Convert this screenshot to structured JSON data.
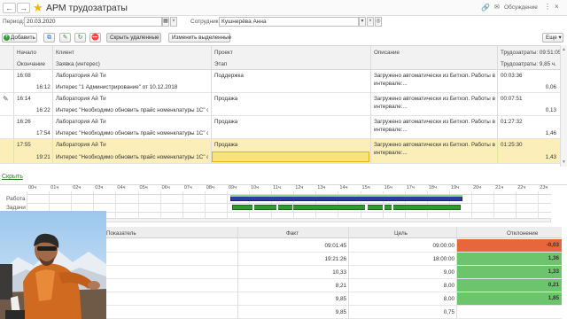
{
  "window": {
    "title": "АРМ трудозатраты",
    "discussion": "Обсуждение"
  },
  "filters": {
    "period_label": "Период:",
    "period_value": "20.03.2020",
    "employee_label": "Сотрудник:",
    "employee_value": "Кушнерёва Анна"
  },
  "toolbar": {
    "add": "Добавить",
    "show_deleted": "Скрыть удаленные",
    "change_selected": "Изменить выделенные",
    "more": "Еще"
  },
  "table": {
    "headers": {
      "start": "Начало",
      "end": "Окончание",
      "client": "Клиент",
      "request": "Заявка (интерес)",
      "project": "Проект",
      "stage": "Этап",
      "description": "Описание",
      "labor": "Трудозатраты: 09:51:05",
      "labor2": "Трудозатраты: 9,85 ч."
    },
    "rows": [
      {
        "start": "16:08",
        "end": "16:12",
        "client": "Лаборатория Ай Ти",
        "request": "Интерес \"1 Администрирование\" от 10.12.2018",
        "project": "Поддержка",
        "stage": "",
        "desc1": "Загружено автоматически из Битхоп. Работы в",
        "desc2": "интервале:...",
        "time": "00:03:36",
        "hours": "0,06"
      },
      {
        "start": "16:14",
        "end": "16:22",
        "client": "Лаборатория Ай Ти",
        "request": "Интерес \"Необходимо обновить прайс номенклатуры 1С\" от ...",
        "project": "Продажа",
        "stage": "",
        "desc1": "Загружено автоматически из Битхоп. Работы в",
        "desc2": "интервале:...",
        "time": "00:07:51",
        "hours": "0,13"
      },
      {
        "start": "16:26",
        "end": "17:54",
        "client": "Лаборатория Ай Ти",
        "request": "Интерес \"Необходимо обновить прайс номенклатуры 1С\" от ...",
        "project": "Продажа",
        "stage": "",
        "desc1": "Загружено автоматически из Битхоп. Работы в",
        "desc2": "интервале:...",
        "time": "01:27:32",
        "hours": "1,46"
      },
      {
        "start": "17:55",
        "end": "19:21",
        "client": "Лаборатория Ай Ти",
        "request": "Интерес \"Необходимо обновить прайс номенклатуры 1С\" от ...",
        "project": "Продажа",
        "stage": "",
        "desc1": "Загружено автоматически из Битхоп. Работы в",
        "desc2": "интервале:...",
        "time": "01:25:30",
        "hours": "1,43"
      }
    ]
  },
  "hide_link": "Скрыть",
  "timeline": {
    "hours": [
      "00ч",
      "01ч",
      "02ч",
      "03ч",
      "04ч",
      "05ч",
      "06ч",
      "07ч",
      "08ч",
      "09ч",
      "10ч",
      "11ч",
      "12ч",
      "13ч",
      "14ч",
      "15ч",
      "16ч",
      "17ч",
      "18ч",
      "19ч",
      "20ч",
      "21ч",
      "22ч",
      "23ч"
    ],
    "rows": [
      "Работа",
      "Задачи"
    ]
  },
  "indicators": {
    "headers": {
      "name": "Показатель",
      "fact": "Факт",
      "goal": "Цель",
      "dev": "Отклонение"
    },
    "rows": [
      {
        "fact": "09:01:45",
        "goal": "09:00:00",
        "dev": "-0,03",
        "color": "#e8663c"
      },
      {
        "fact": "19:21:26",
        "goal": "18:00:00",
        "dev": "1,36",
        "color": "#6cc56c"
      },
      {
        "fact": "10,33",
        "goal": "9,00",
        "dev": "1,33",
        "color": "#6cc56c"
      },
      {
        "fact": "8,21",
        "goal": "8,00",
        "dev": "0,21",
        "color": "#6cc56c"
      },
      {
        "fact": "9,85",
        "goal": "8,00",
        "dev": "1,85",
        "color": "#6cc56c"
      },
      {
        "fact": "9,85",
        "goal": "0,75",
        "dev": "",
        "color": ""
      }
    ]
  },
  "colors": {
    "accent_green": "#3a9a3a",
    "selected_row": "#fbeeb9",
    "work_bar": "#2b3d9c",
    "task_bar": "#2e9b2e"
  }
}
